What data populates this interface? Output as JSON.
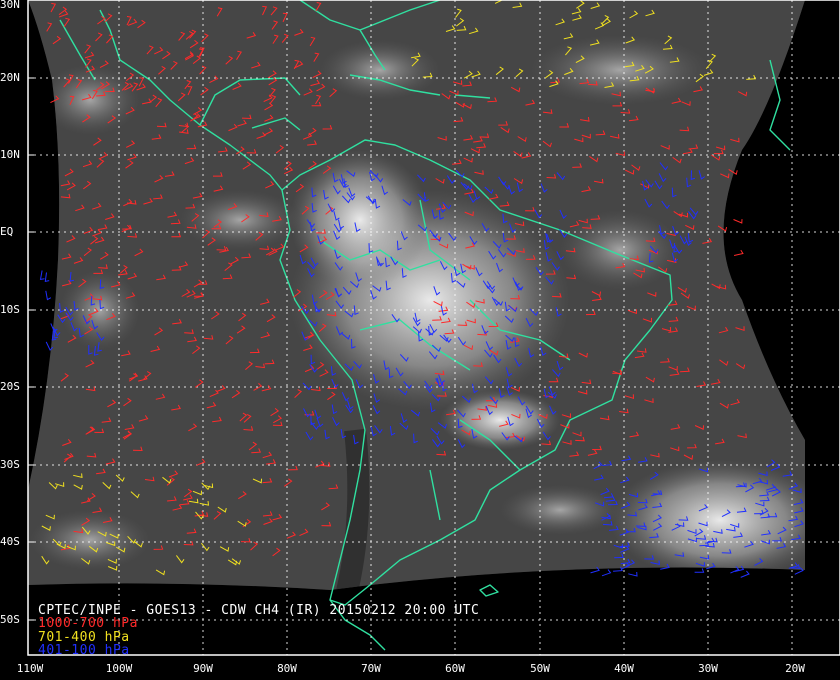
{
  "caption": {
    "title": "CPTEC/INPE - GOES13 - CDW CH4 (IR) 20150212 20:00 UTC",
    "legend": [
      {
        "label": "1000-700 hPa",
        "color": "#ff2a2a"
      },
      {
        "label": "701-400 hPa",
        "color": "#f0e020"
      },
      {
        "label": "401-100 hPa",
        "color": "#2030ff"
      }
    ]
  },
  "grid": {
    "lat_labels": [
      "30N",
      "20N",
      "10N",
      "EQ",
      "10S",
      "20S",
      "30S",
      "40S",
      "50S"
    ],
    "lon_labels": [
      "110W",
      "100W",
      "90W",
      "80W",
      "70W",
      "60W",
      "50W",
      "40W",
      "30W",
      "20W"
    ]
  },
  "colors": {
    "background": "#000000",
    "coastline": "#30e0a0",
    "gridline": "#ffffff",
    "frame": "#ffffff"
  }
}
